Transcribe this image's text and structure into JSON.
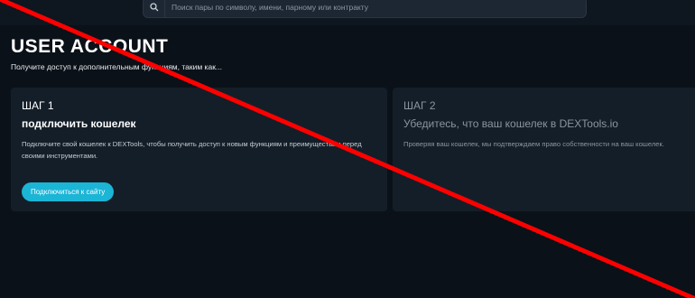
{
  "search": {
    "placeholder": "Поиск пары по символу, имени, парному или контракту",
    "icon": "search-icon"
  },
  "page": {
    "title": "USER ACCOUNT",
    "subtitle": "Получите доступ к дополнительным функциям, таким как..."
  },
  "steps": [
    {
      "label": "ШАГ 1",
      "title": "подключить кошелек",
      "description": "Подключите свой кошелек к DEXTools, чтобы получить доступ к новым функциям и преимуществам перед своими инструментами.",
      "button_label": "Подключиться к сайту"
    },
    {
      "label": "ШАГ 2",
      "title": "Убедитесь, что ваш кошелек в DEXTools.io",
      "description": "Проверяя ваш кошелек, мы подтверждаем право собственности на ваш кошелек."
    }
  ],
  "colors": {
    "background": "#0b1118",
    "card": "#141e28",
    "accent": "#1bb5d6",
    "strike_line": "#ff0000"
  }
}
